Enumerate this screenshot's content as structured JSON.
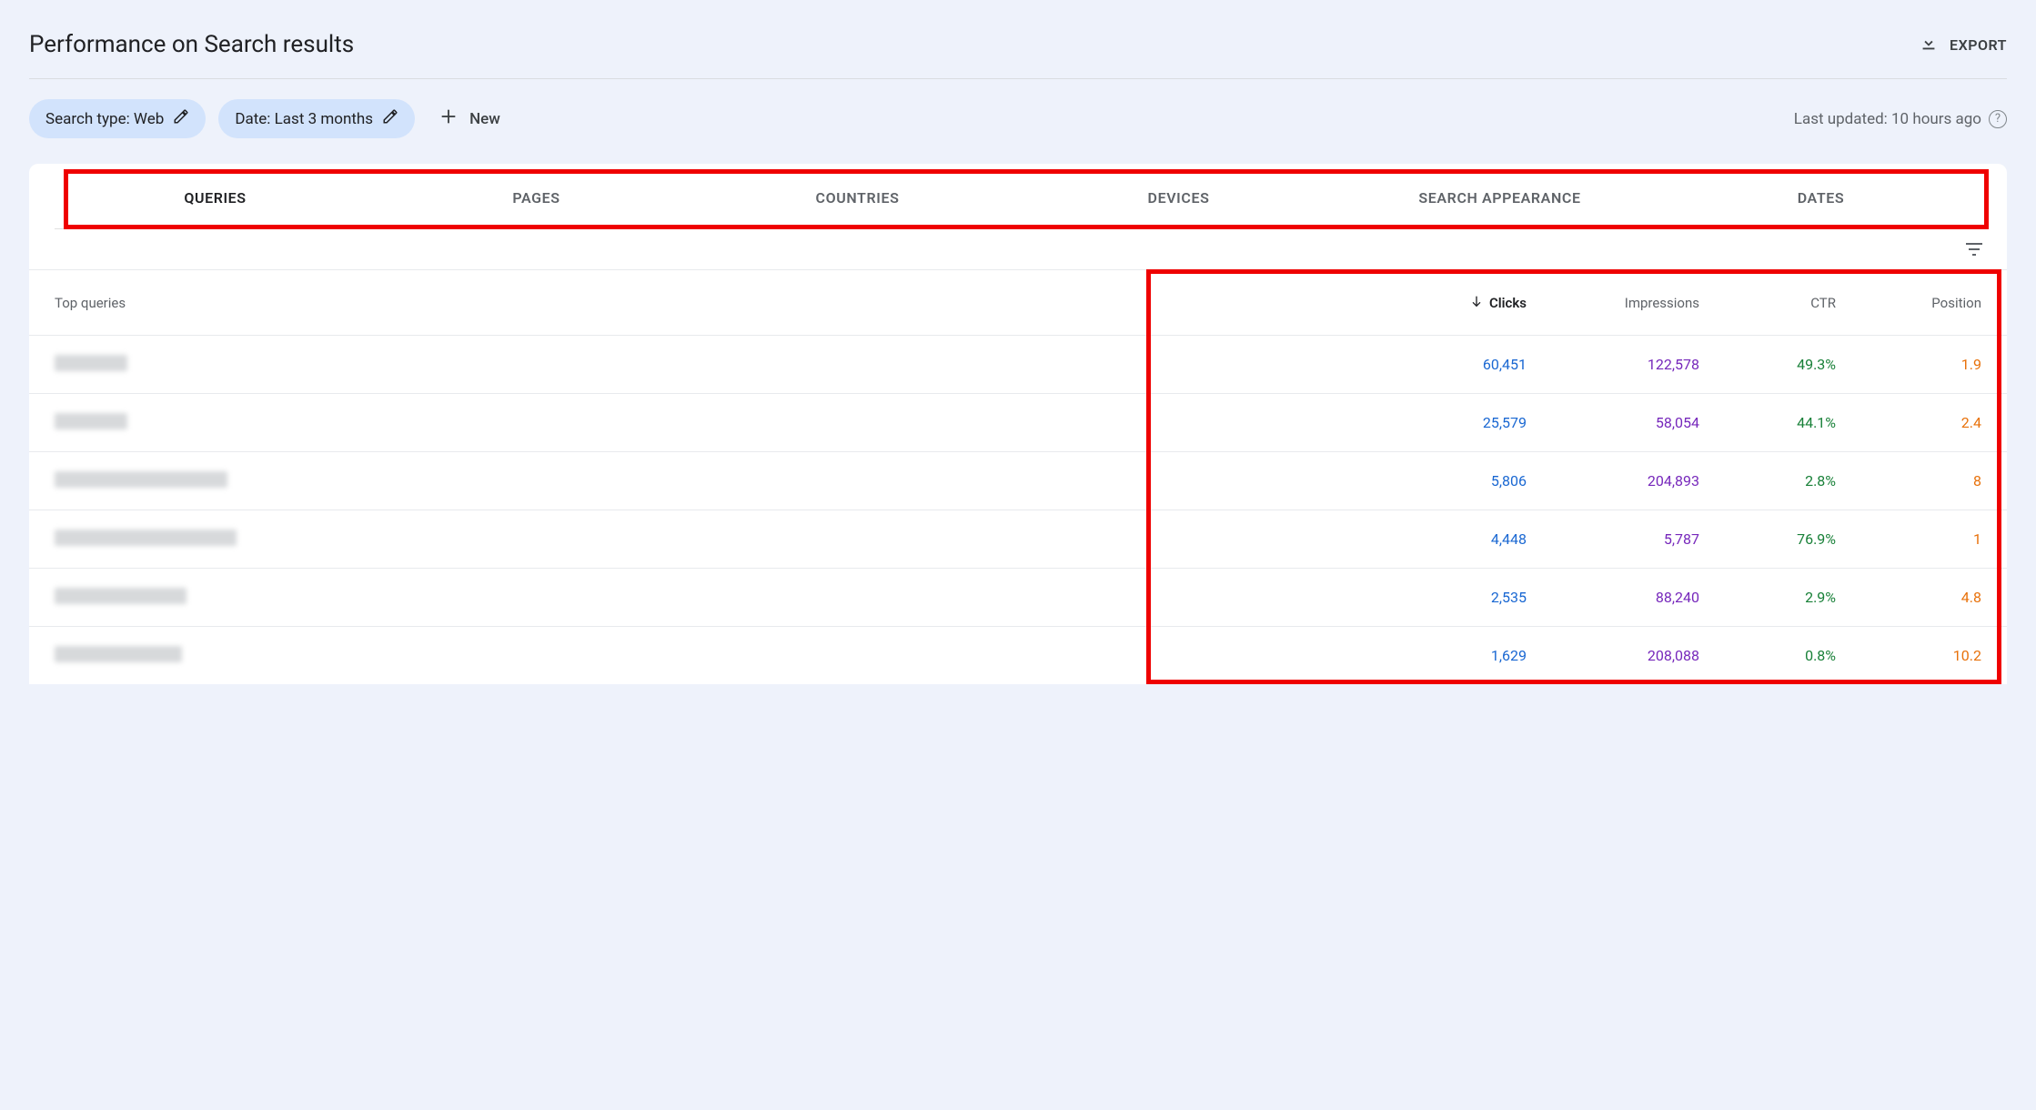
{
  "header": {
    "title": "Performance on Search results",
    "export_label": "EXPORT"
  },
  "filters": {
    "chips": [
      {
        "label": "Search type: Web"
      },
      {
        "label": "Date: Last 3 months"
      }
    ],
    "new_label": "New",
    "last_updated": "Last updated: 10 hours ago"
  },
  "tabs": [
    {
      "label": "QUERIES",
      "active": true
    },
    {
      "label": "PAGES",
      "active": false
    },
    {
      "label": "COUNTRIES",
      "active": false
    },
    {
      "label": "DEVICES",
      "active": false
    },
    {
      "label": "SEARCH APPEARANCE",
      "active": false
    },
    {
      "label": "DATES",
      "active": false
    }
  ],
  "table": {
    "columns": {
      "query": "Top queries",
      "clicks": "Clicks",
      "impressions": "Impressions",
      "ctr": "CTR",
      "position": "Position"
    },
    "sorted_by": "clicks",
    "sort_dir": "desc",
    "rows": [
      {
        "query_blur_w": 80,
        "clicks": "60,451",
        "impressions": "122,578",
        "ctr": "49.3%",
        "position": "1.9"
      },
      {
        "query_blur_w": 80,
        "clicks": "25,579",
        "impressions": "58,054",
        "ctr": "44.1%",
        "position": "2.4"
      },
      {
        "query_blur_w": 190,
        "clicks": "5,806",
        "impressions": "204,893",
        "ctr": "2.8%",
        "position": "8"
      },
      {
        "query_blur_w": 200,
        "clicks": "4,448",
        "impressions": "5,787",
        "ctr": "76.9%",
        "position": "1"
      },
      {
        "query_blur_w": 145,
        "clicks": "2,535",
        "impressions": "88,240",
        "ctr": "2.9%",
        "position": "4.8"
      },
      {
        "query_blur_w": 140,
        "clicks": "1,629",
        "impressions": "208,088",
        "ctr": "0.8%",
        "position": "10.2"
      }
    ]
  }
}
